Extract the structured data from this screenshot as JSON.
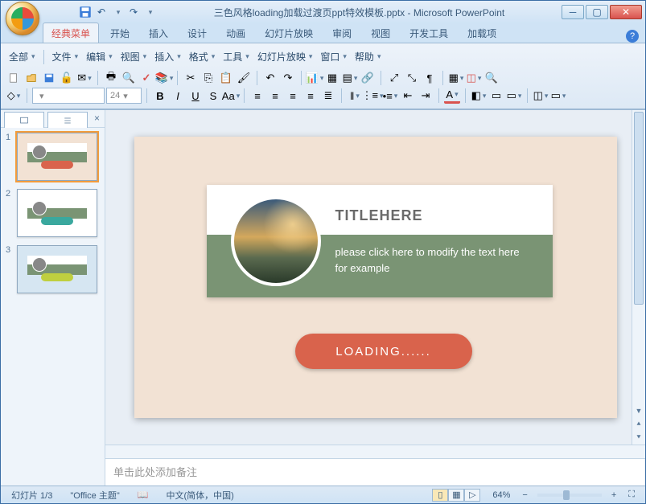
{
  "window": {
    "doc_title": "三色风格loading加载过渡页ppt特效模板.pptx",
    "app_name": "Microsoft PowerPoint"
  },
  "ribbon_tabs": [
    "经典菜单",
    "开始",
    "插入",
    "设计",
    "动画",
    "幻灯片放映",
    "审阅",
    "视图",
    "开发工具",
    "加载项"
  ],
  "classic_menu": [
    "全部",
    "文件",
    "编辑",
    "视图",
    "插入",
    "格式",
    "工具",
    "幻灯片放映",
    "窗口",
    "帮助"
  ],
  "font": {
    "family": "",
    "size": "24"
  },
  "slide": {
    "title": "TITLEHERE",
    "subtitle": "please click here to modify the text here for example",
    "loading": "LOADING......"
  },
  "thumbs": [
    {
      "n": "1",
      "bg": "#f2e2d4",
      "accent": "#d9634c",
      "selected": true
    },
    {
      "n": "2",
      "bg": "#ffffff",
      "accent": "#3aa89e",
      "selected": false
    },
    {
      "n": "3",
      "bg": "#d6e6f2",
      "accent": "#bfcf3f",
      "selected": false
    }
  ],
  "notes_placeholder": "单击此处添加备注",
  "status": {
    "slide_counter": "幻灯片 1/3",
    "theme": "\"Office 主题\"",
    "lang": "中文(简体，中国)",
    "zoom": "64%"
  }
}
